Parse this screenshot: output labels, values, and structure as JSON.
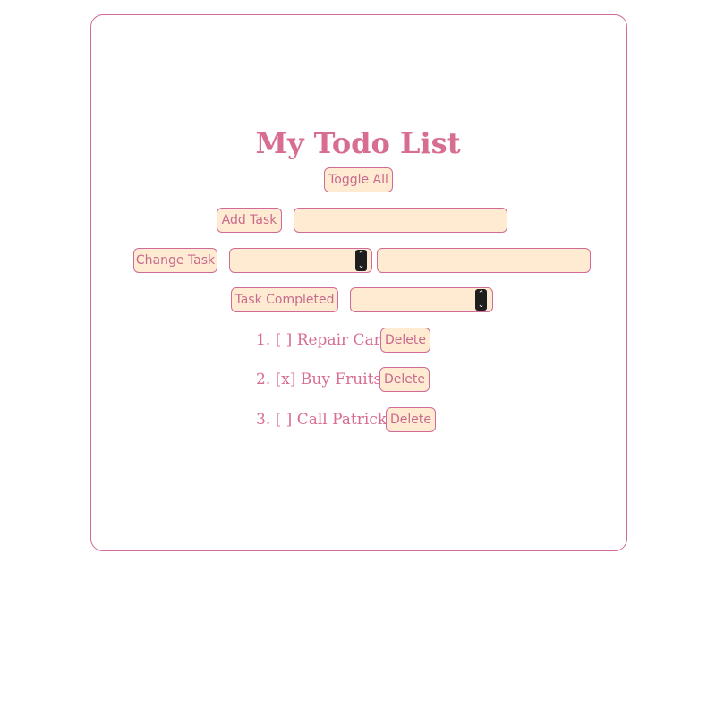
{
  "title": "My Todo List",
  "toggle_all_label": "Toggle All",
  "add_task": {
    "button_label": "Add Task",
    "input_value": ""
  },
  "change_task": {
    "button_label": "Change Task",
    "number_value": "",
    "text_value": ""
  },
  "task_completed": {
    "button_label": "Task Completed",
    "number_value": ""
  },
  "tasks": [
    {
      "text": "1. [ ] Repair Car",
      "delete_label": "Delete"
    },
    {
      "text": "2. [x] Buy Fruits",
      "delete_label": "Delete"
    },
    {
      "text": "3. [ ] Call Patrick",
      "delete_label": "Delete"
    }
  ],
  "colors": {
    "accent": "#d86d92",
    "border": "#d06a96",
    "control_bg": "#ffebd1"
  }
}
